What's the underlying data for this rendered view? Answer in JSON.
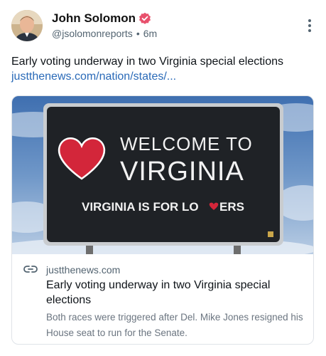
{
  "author": {
    "name": "John Solomon",
    "handle": "@jsolomonreports",
    "time": "6m",
    "separator": "•"
  },
  "post": {
    "text": "Early voting underway in two Virginia special elections",
    "link": "justthenews.com/nation/states/..."
  },
  "card": {
    "domain": "justthenews.com",
    "title": "Early voting underway in two Virginia special elections",
    "description": "Both races were triggered after Del. Mike Jones resigned his House seat to run for the Senate.",
    "sign": {
      "line1": "WELCOME TO",
      "line2": "VIRGINIA",
      "line3a": "VIRGINIA IS FOR LO",
      "line3b": "ERS"
    }
  },
  "icons": {
    "verified": "verified-badge-icon",
    "more": "more-vertical-icon",
    "link": "link-icon",
    "heart": "heart-icon"
  },
  "colors": {
    "verified": "#e8506c",
    "link": "#2a6ab8",
    "heart": "#d3263a",
    "sign_bg": "#1f2226"
  }
}
